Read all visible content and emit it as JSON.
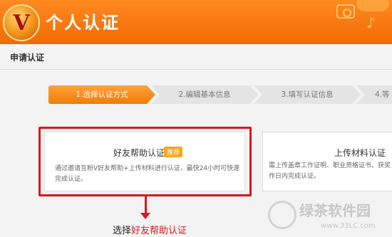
{
  "header": {
    "logo_letter": "V",
    "title": "个人认证"
  },
  "section": {
    "title": "申请认证"
  },
  "steps": [
    {
      "label": "1.选择认证方式"
    },
    {
      "label": "2.编辑基本信息"
    },
    {
      "label": "3.填写认证信息"
    },
    {
      "label": "4.等"
    }
  ],
  "cards": {
    "friend": {
      "title": "好友帮助认证",
      "badge": "推荐",
      "desc": "通过邀请互粉V好友帮助+上传材料进行认证，最快24小时可快速完成认证。"
    },
    "upload": {
      "title": "上传材料认证",
      "desc_line1": "需上传盖章工作证明、职业资格证书、获奖",
      "desc_line2": "作日内完成认证。"
    }
  },
  "caption": {
    "prefix": "选择",
    "highlight": "好友帮助认证"
  },
  "watermark": {
    "text": "绿茶软件园",
    "url": "www.33LC.com"
  },
  "colors": {
    "header_orange": "#f36a05",
    "active_step": "#f07c06",
    "highlight_red": "#d8181d",
    "badge": "#f5a623"
  }
}
